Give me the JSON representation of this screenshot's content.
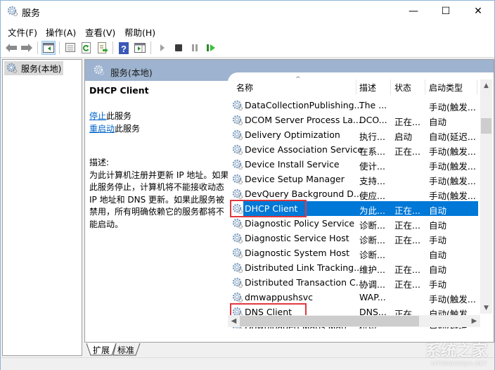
{
  "window": {
    "title": "服务",
    "controls": {
      "minimize": "—",
      "maximize": "☐",
      "close": "✕"
    }
  },
  "menu": [
    {
      "label": "文件(F)"
    },
    {
      "label": "操作(A)"
    },
    {
      "label": "查看(V)"
    },
    {
      "label": "帮助(H)"
    }
  ],
  "toolbar": [
    {
      "name": "back",
      "icon": "back-arrow-icon"
    },
    {
      "name": "forward",
      "icon": "forward-arrow-icon"
    },
    {
      "name": "show-hide-console-tree",
      "icon": "console-tree-icon",
      "active": true
    },
    {
      "name": "properties",
      "icon": "properties-icon"
    },
    {
      "name": "refresh",
      "icon": "refresh-icon"
    },
    {
      "name": "export-list",
      "icon": "export-list-icon"
    },
    {
      "name": "help",
      "icon": "help-icon"
    },
    {
      "name": "show-action-pane",
      "icon": "action-pane-icon"
    },
    {
      "name": "start-service",
      "icon": "play-icon"
    },
    {
      "name": "stop-service",
      "icon": "stop-icon"
    },
    {
      "name": "pause-service",
      "icon": "pause-icon"
    },
    {
      "name": "restart-service",
      "icon": "restart-icon"
    }
  ],
  "tree": {
    "item": "服务(本地)"
  },
  "panel": {
    "header": "服务(本地)",
    "selected_service": "DHCP Client",
    "actions": [
      {
        "link": "停止",
        "suffix": "此服务"
      },
      {
        "link": "重启动",
        "suffix": "此服务"
      }
    ],
    "description_label": "描述:",
    "description": "为此计算机注册并更新 IP 地址。如果此服务停止，计算机将不能接收动态 IP 地址和 DNS 更新。如果此服务被禁用，所有明确依赖它的服务都将不能启动。"
  },
  "list": {
    "columns": [
      "名称",
      "描述",
      "状态",
      "启动类型"
    ],
    "sort_indicator": "^",
    "rows": [
      {
        "name": "DataCollectionPublishing...",
        "desc": "The ...",
        "status": "",
        "start": "手动(触发..."
      },
      {
        "name": "DCOM Server Process La...",
        "desc": "DCO...",
        "status": "正在...",
        "start": "自动"
      },
      {
        "name": "Delivery Optimization",
        "desc": "执行...",
        "status": "启动",
        "start": "自动(延迟..."
      },
      {
        "name": "Device Association Service",
        "desc": "在系...",
        "status": "正在...",
        "start": "手动(触发..."
      },
      {
        "name": "Device Install Service",
        "desc": "使计...",
        "status": "",
        "start": "手动(触发..."
      },
      {
        "name": "Device Setup Manager",
        "desc": "支持...",
        "status": "",
        "start": "手动(触发..."
      },
      {
        "name": "DevQuery Background D...",
        "desc": "使应...",
        "status": "",
        "start": "手动(触发..."
      },
      {
        "name": "DHCP Client",
        "desc": "为此...",
        "status": "正在...",
        "start": "自动",
        "selected": true,
        "highlighted": true
      },
      {
        "name": "Diagnostic Policy Service",
        "desc": "诊断...",
        "status": "正在...",
        "start": "自动"
      },
      {
        "name": "Diagnostic Service Host",
        "desc": "诊断...",
        "status": "正在...",
        "start": "手动"
      },
      {
        "name": "Diagnostic System Host",
        "desc": "诊断...",
        "status": "",
        "start": "自动"
      },
      {
        "name": "Distributed Link Tracking...",
        "desc": "维护...",
        "status": "正在...",
        "start": "自动"
      },
      {
        "name": "Distributed Transaction C...",
        "desc": "协调...",
        "status": "正在...",
        "start": "手动"
      },
      {
        "name": "dmwappushsvc",
        "desc": "WAP...",
        "status": "",
        "start": "手动(触发..."
      },
      {
        "name": "DNS Client",
        "desc": "DNS...",
        "status": "正在...",
        "start": "自动(触发...",
        "highlighted": true
      },
      {
        "name": "Downloaded Maps Man...",
        "desc": "供应...",
        "status": "",
        "start": "自动(延迟..."
      }
    ]
  },
  "tabs": [
    {
      "label": "扩展",
      "active": true
    },
    {
      "label": "标准",
      "active": false
    }
  ],
  "watermark": {
    "main": "系统之家",
    "sub": "XITONGZHIJIA.NET"
  },
  "colors": {
    "selection": "#0078d7",
    "panel_header": "#9db3cf",
    "highlight_box": "#e0383e",
    "link": "#0066cc"
  }
}
